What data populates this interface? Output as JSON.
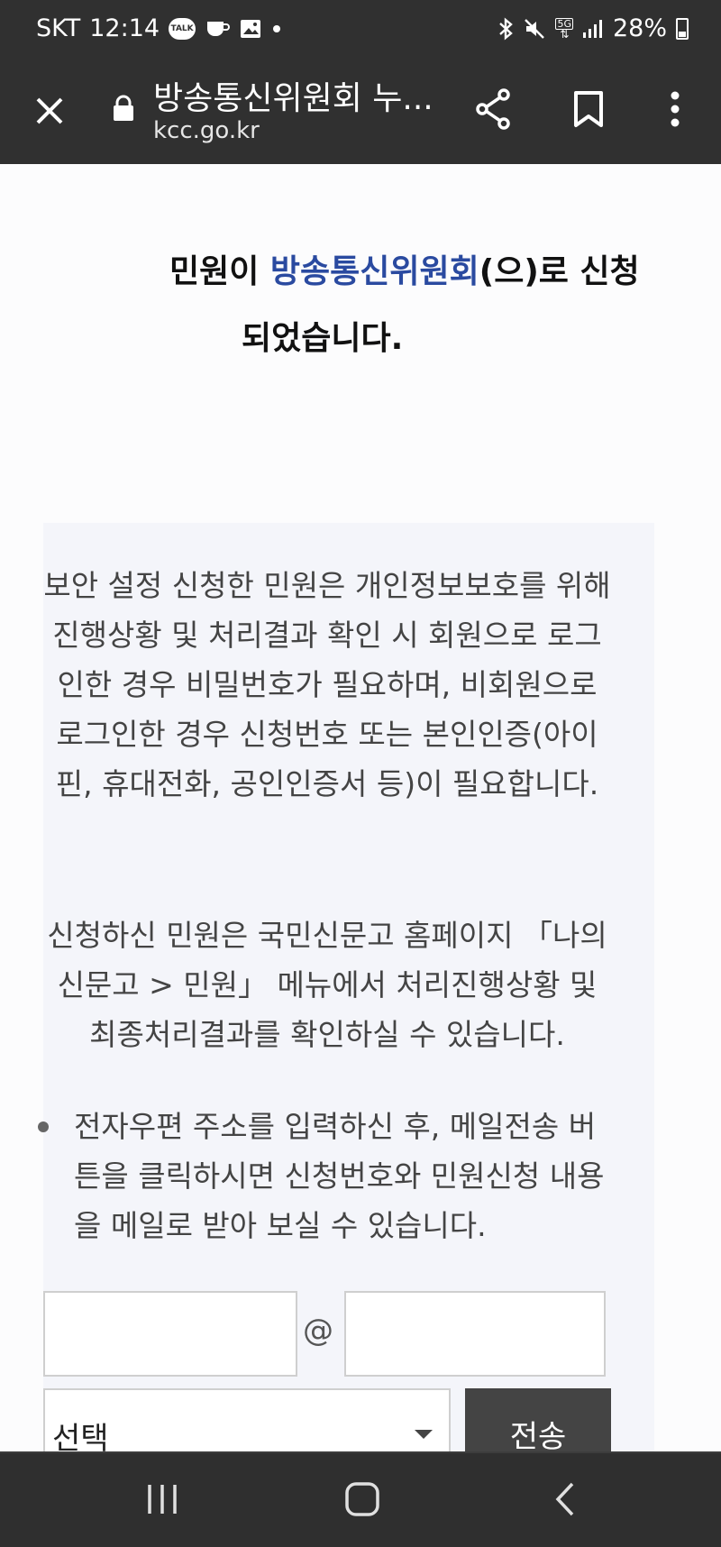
{
  "status_bar": {
    "carrier": "SKT",
    "time": "12:14",
    "talk_label": "TALK",
    "network": "5G",
    "battery": "28%"
  },
  "toolbar": {
    "page_title": "방송통신위원회 누...",
    "domain": "kcc.go.kr"
  },
  "content": {
    "headline": {
      "prefix": "민원이 ",
      "org": "방송통신위원회",
      "suffix": "(으)로 신청",
      "line2": "되었습니다."
    },
    "notice1": "보안 설정 신청한 민원은 개인정보보호를 위해 진행상황 및 처리결과 확인 시 회원으로 로그인한 경우 비밀번호가 필요하며, 비회원으로 로그인한 경우 신청번호 또는 본인인증(아이핀, 휴대전화, 공인인증서 등)이 필요합니다.",
    "notice2": "신청하신 민원은 국민신문고 홈페이지 「나의 신문고 > 민원」 메뉴에서 처리진행상황 및 최종처리결과를 확인하실 수 있습니다.",
    "email_notice": "전자우편 주소를 입력하신 후, 메일전송 버튼을 클릭하시면 신청번호와 민원신청 내용을 메일로 받아 보실 수 있습니다.",
    "email_form": {
      "local_value": "",
      "at_sign": "@",
      "domain_value": "",
      "select_value": "선택",
      "send_label": "전송"
    }
  },
  "colors": {
    "chrome_bg": "#303030",
    "accent": "#2a4aa0",
    "panel_bg": "#f4f5fa",
    "button_bg": "#444444"
  },
  "icons": [
    "close-icon",
    "lock-icon",
    "share-icon",
    "bookmark-icon",
    "more-vert-icon",
    "recent-apps-icon",
    "home-icon",
    "back-icon"
  ]
}
